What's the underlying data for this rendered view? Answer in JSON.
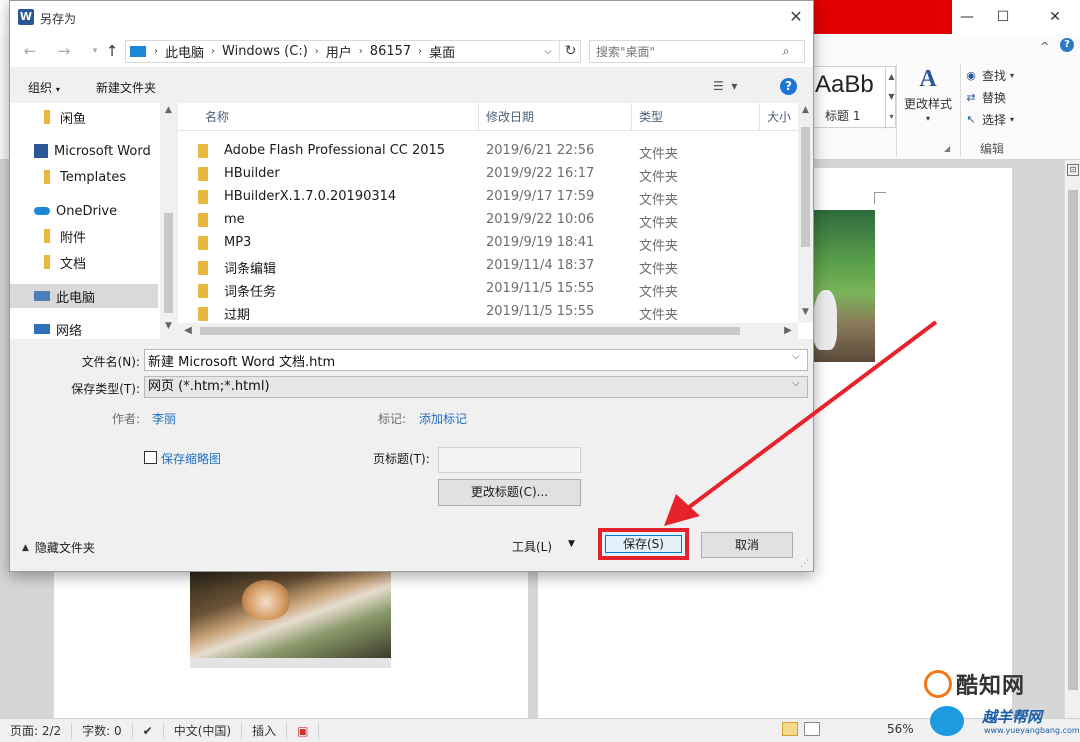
{
  "word": {
    "ribbon": {
      "style_sample": "AaBb",
      "style_name": "标题 1",
      "change_styles_label": "更改样式",
      "find_label": "查找",
      "replace_label": "替换",
      "select_label": "选择",
      "editing_group_label": "编辑",
      "help_glyph": "?",
      "collapse_glyph": "^"
    },
    "window_controls": {
      "minimize": "—",
      "maximize": "☐",
      "close": "✕"
    },
    "statusbar": {
      "page": "页面: 2/2",
      "words": "字数: 0",
      "language": "中文(中国)",
      "insert_mode": "插入",
      "zoom": "56%"
    }
  },
  "dialog": {
    "title": "另存为",
    "close_glyph": "✕",
    "app_icon_letter": "W",
    "nav": {
      "back": "←",
      "forward": "→",
      "up": "↑"
    },
    "breadcrumb": [
      "此电脑",
      "Windows (C:)",
      "用户",
      "86157",
      "桌面"
    ],
    "search_placeholder": "搜索\"桌面\"",
    "toolbar": {
      "organize": "组织",
      "new_folder": "新建文件夹",
      "help_glyph": "?"
    },
    "nav_pane": [
      {
        "label": "闲鱼",
        "icon": "folder-icon"
      },
      {
        "label": "Microsoft Word",
        "icon": "word-icon"
      },
      {
        "label": "Templates",
        "icon": "folder-icon"
      },
      {
        "label": "OneDrive",
        "icon": "cloud-icon"
      },
      {
        "label": "附件",
        "icon": "folder-icon"
      },
      {
        "label": "文档",
        "icon": "folder-icon"
      },
      {
        "label": "此电脑",
        "icon": "computer-icon",
        "selected": true
      },
      {
        "label": "网络",
        "icon": "network-icon"
      }
    ],
    "columns": [
      "名称",
      "修改日期",
      "类型",
      "大小"
    ],
    "files": [
      {
        "name": "Adobe Flash Professional CC 2015",
        "date": "2019/6/21 22:56",
        "type": "文件夹"
      },
      {
        "name": "HBuilder",
        "date": "2019/9/22 16:17",
        "type": "文件夹"
      },
      {
        "name": "HBuilderX.1.7.0.20190314",
        "date": "2019/9/17 17:59",
        "type": "文件夹"
      },
      {
        "name": "me",
        "date": "2019/9/22 10:06",
        "type": "文件夹"
      },
      {
        "name": "MP3",
        "date": "2019/9/19 18:41",
        "type": "文件夹"
      },
      {
        "name": "词条编辑",
        "date": "2019/11/4 18:37",
        "type": "文件夹"
      },
      {
        "name": "词条任务",
        "date": "2019/11/5 15:55",
        "type": "文件夹"
      },
      {
        "name": "过期",
        "date": "2019/11/5 15:55",
        "type": "文件夹"
      }
    ],
    "filename_label": "文件名(N):",
    "filename_value": "新建 Microsoft Word 文档.htm",
    "filetype_label": "保存类型(T):",
    "filetype_value": "网页 (*.htm;*.html)",
    "author_label": "作者:",
    "author_value": "李丽",
    "tags_label": "标记:",
    "tags_value": "添加标记",
    "thumbnail_label": "保存缩略图",
    "page_title_label": "页标题(T):",
    "change_title_label": "更改标题(C)...",
    "hide_folders_label": "隐藏文件夹",
    "tools_label": "工具(L)",
    "save_label": "保存(S)",
    "cancel_label": "取消"
  },
  "watermarks": {
    "site1": "酷知网",
    "site2": "越羊帮网",
    "site2_url": "www.yueyangbang.com"
  },
  "colors": {
    "accent_blue": "#1e73d8",
    "highlight_red": "#e8222a",
    "folder_yellow": "#e8b73e",
    "link_blue": "#1e6fc4"
  }
}
